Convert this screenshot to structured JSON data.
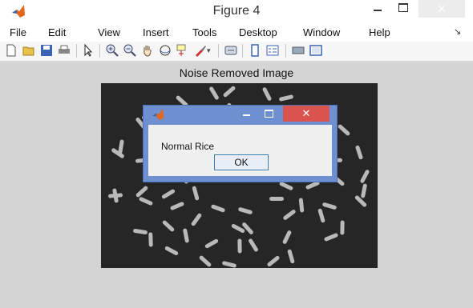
{
  "window": {
    "title": "Figure 4",
    "close_glyph": "✕"
  },
  "menu": [
    "File",
    "Edit",
    "View",
    "Insert",
    "Tools",
    "Desktop",
    "Window",
    "Help"
  ],
  "menu_overflow_glyph": "↘",
  "toolbar_icons": [
    "new-figure-icon",
    "open-file-icon",
    "save-icon",
    "print-icon",
    "edit-plot-arrow-icon",
    "zoom-in-icon",
    "zoom-out-icon",
    "pan-hand-icon",
    "rotate-3d-icon",
    "data-cursor-icon",
    "brush-icon",
    "brush-dropdown-icon",
    "link-plot-icon",
    "insert-colorbar-icon",
    "insert-legend-icon",
    "hide-plot-tools-icon",
    "show-plot-tools-icon"
  ],
  "figure": {
    "axes_title": "Noise Removed Image"
  },
  "dialog": {
    "message": "Normal Rice",
    "ok_label": "OK",
    "close_glyph": "✕"
  },
  "colors": {
    "dialog_frame": "#6e8fd0",
    "close_button": "#d9534f",
    "figure_background": "#d4d4d4",
    "image_background": "#262626",
    "rice_grain": "#b9b9b9"
  }
}
